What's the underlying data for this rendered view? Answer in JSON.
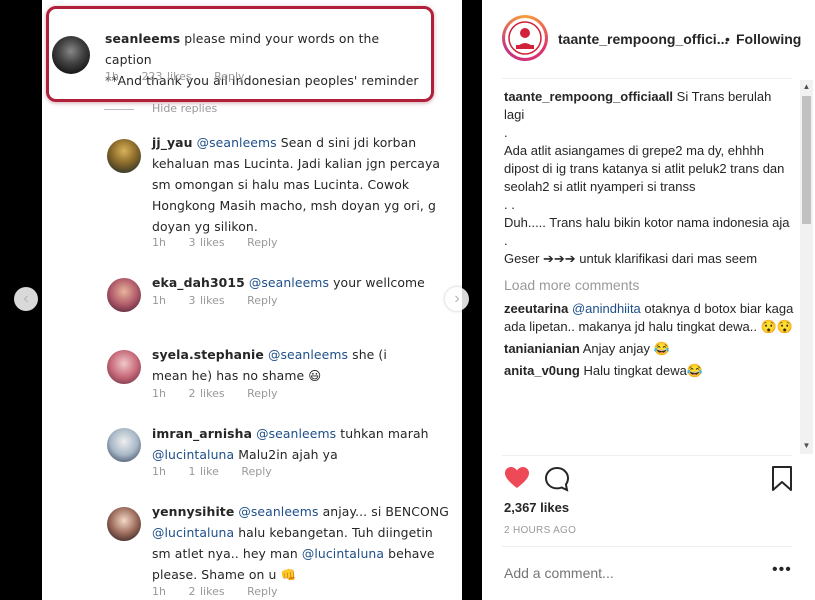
{
  "screenshot": {
    "comments": [
      {
        "user": "seanleems",
        "mention": "",
        "text": "please mind your words on the caption",
        "text2": "**And thank you all Indonesian peoples' reminder",
        "time": "1h",
        "likes": "223 likes",
        "reply": "Reply"
      },
      {
        "user": "jj_yau",
        "mention": "@seanleems",
        "text": "Sean d sini jdi korban kehaluan mas Lucinta. Jadi kalian jgn percaya sm omongan si halu mas Lucinta. Cowok Hongkong Masih macho, msh doyan yg ori, g doyan yg silikon.",
        "time": "1h",
        "likes": "3 likes",
        "reply": "Reply"
      },
      {
        "user": "eka_dah3015",
        "mention": "@seanleems",
        "text": "your wellcome",
        "time": "1h",
        "likes": "3 likes",
        "reply": "Reply"
      },
      {
        "user": "syela.stephanie",
        "mention": "@seanleems",
        "text": "she (i mean he) has no shame 😃",
        "time": "1h",
        "likes": "2 likes",
        "reply": "Reply"
      },
      {
        "user": "imran_arnisha",
        "mention": "@seanleems",
        "text": "tuhkan marah",
        "mention2": "@lucintaluna",
        "text2": "Malu2in ajah ya",
        "time": "1h",
        "likes": "1 like",
        "reply": "Reply"
      },
      {
        "user": "yennysihite",
        "mention": "@seanleems",
        "text": "anjay... si BENCONG",
        "mention2": "@lucintaluna",
        "text2": "halu kebangetan. Tuh diingetin sm atlet nya.. hey man",
        "mention3": "@lucintaluna",
        "text3": "behave please. Shame on u 👊",
        "time": "1h",
        "likes": "2 likes",
        "reply": "Reply"
      }
    ],
    "hide_replies": "Hide replies"
  },
  "post": {
    "username": "taante_rempoong_offici...",
    "following": "Following",
    "caption_user": "taante_rempoong_officiaall",
    "caption_lines": [
      "Si Trans berulah lagi",
      ".",
      "Ada atlit asiangames di grepe2 ma dy, ehhhh dipost di ig trans katanya si atlit peluk2 trans dan seolah2 si atlit nyamperi si transs",
      ". .",
      "Duh..... Trans halu bikin kotor nama indonesia aja",
      ".",
      "Geser ➔➔➔ untuk klarifikasi dari mas seem"
    ],
    "load_more": "Load more comments",
    "comments": [
      {
        "user": "zeeutarina",
        "mention": "@anindhiita",
        "text": "otaknya d botox biar kaga ada lipetan.. makanya jd halu tingkat dewa.. 😯😯"
      },
      {
        "user": "tanianianian",
        "mention": "",
        "text": "Anjay anjay 😂"
      },
      {
        "user": "anita_v0ung",
        "mention": "",
        "text": "Halu tingkat dewa😂"
      }
    ],
    "likes": "2,367 likes",
    "time": "2 HOURS AGO",
    "add_comment_placeholder": "Add a comment...",
    "more_icon": "more-options-icon"
  },
  "colors": {
    "highlight_box": "#b0203a",
    "heart": "#ed4956",
    "mention": "#1d4e89"
  }
}
